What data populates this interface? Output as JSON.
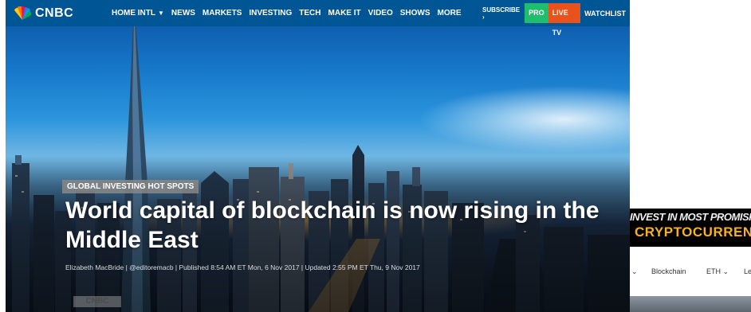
{
  "cnbc": {
    "logo": "CNBC",
    "nav": {
      "items": [
        {
          "label": "HOME INTL",
          "has_dropdown": true
        },
        {
          "label": "NEWS"
        },
        {
          "label": "MARKETS"
        },
        {
          "label": "INVESTING"
        },
        {
          "label": "TECH"
        },
        {
          "label": "MAKE IT"
        },
        {
          "label": "VIDEO"
        },
        {
          "label": "SHOWS"
        },
        {
          "label": "MORE"
        }
      ],
      "subscribe": "SUBSCRIBE ›",
      "pro": "PRO",
      "live_tv": "LIVE TV",
      "watchlist": "WATCHLIST"
    },
    "article": {
      "kicker": "GLOBAL INVESTING HOT SPOTS",
      "headline": "World capital of blockchain is now rising in the Middle East",
      "byline": "Elizabeth MacBride | @editoremacb | Published 8:54 AM ET Mon, 6 Nov 2017 | Updated 2:55 PM ET Thu, 9 Nov 2017"
    },
    "watermark": "CNBC",
    "colors": {
      "nav_bg": "#005594",
      "pro": "#1fbd6e",
      "live_tv": "#e8521c"
    }
  },
  "crypto_site": {
    "banner_line1": "INVEST IN MOST PROMISING",
    "banner_line2": "CRYPTOCURRENCY",
    "nav": [
      {
        "label": "⌄"
      },
      {
        "label": "Blockchain"
      },
      {
        "label": "ETH ⌄"
      },
      {
        "label": "Le"
      }
    ],
    "colors": {
      "banner_bg": "#000000",
      "accent": "#f7b21c"
    }
  }
}
